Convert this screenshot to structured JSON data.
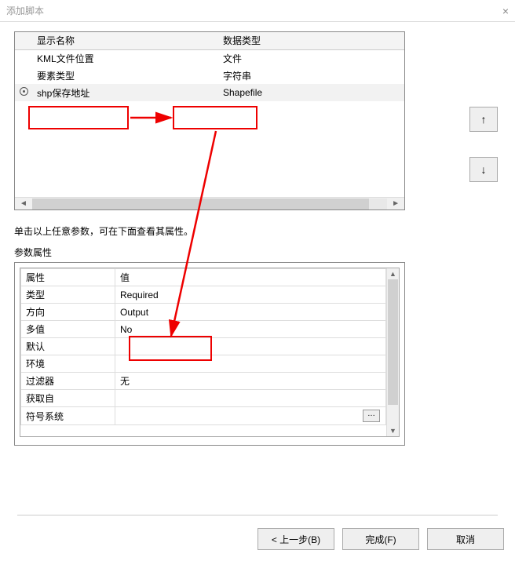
{
  "window": {
    "title": "添加脚本",
    "close": "×"
  },
  "table": {
    "headers": {
      "name": "显示名称",
      "type": "数据类型"
    },
    "rows": [
      {
        "name": "KML文件位置",
        "type": "文件"
      },
      {
        "name": "要素类型",
        "type": "字符串"
      },
      {
        "name": "shp保存地址",
        "type": "Shapefile"
      }
    ]
  },
  "sideButtons": {
    "up": "↑",
    "down": "↓"
  },
  "hint": "单击以上任意参数，可在下面查看其属性。",
  "propsLabel": "参数属性",
  "props": {
    "header": {
      "attr": "属性",
      "val": "值"
    },
    "rows": [
      {
        "attr": "类型",
        "val": "Required"
      },
      {
        "attr": "方向",
        "val": "Output"
      },
      {
        "attr": "多值",
        "val": "No"
      },
      {
        "attr": "默认",
        "val": ""
      },
      {
        "attr": "环境",
        "val": ""
      },
      {
        "attr": "过滤器",
        "val": "无"
      },
      {
        "attr": "获取自",
        "val": ""
      },
      {
        "attr": "符号系统",
        "val": "",
        "ellipsis": true
      }
    ]
  },
  "footer": {
    "back": "< 上一步(B)",
    "finish": "完成(F)",
    "cancel": "取消"
  }
}
